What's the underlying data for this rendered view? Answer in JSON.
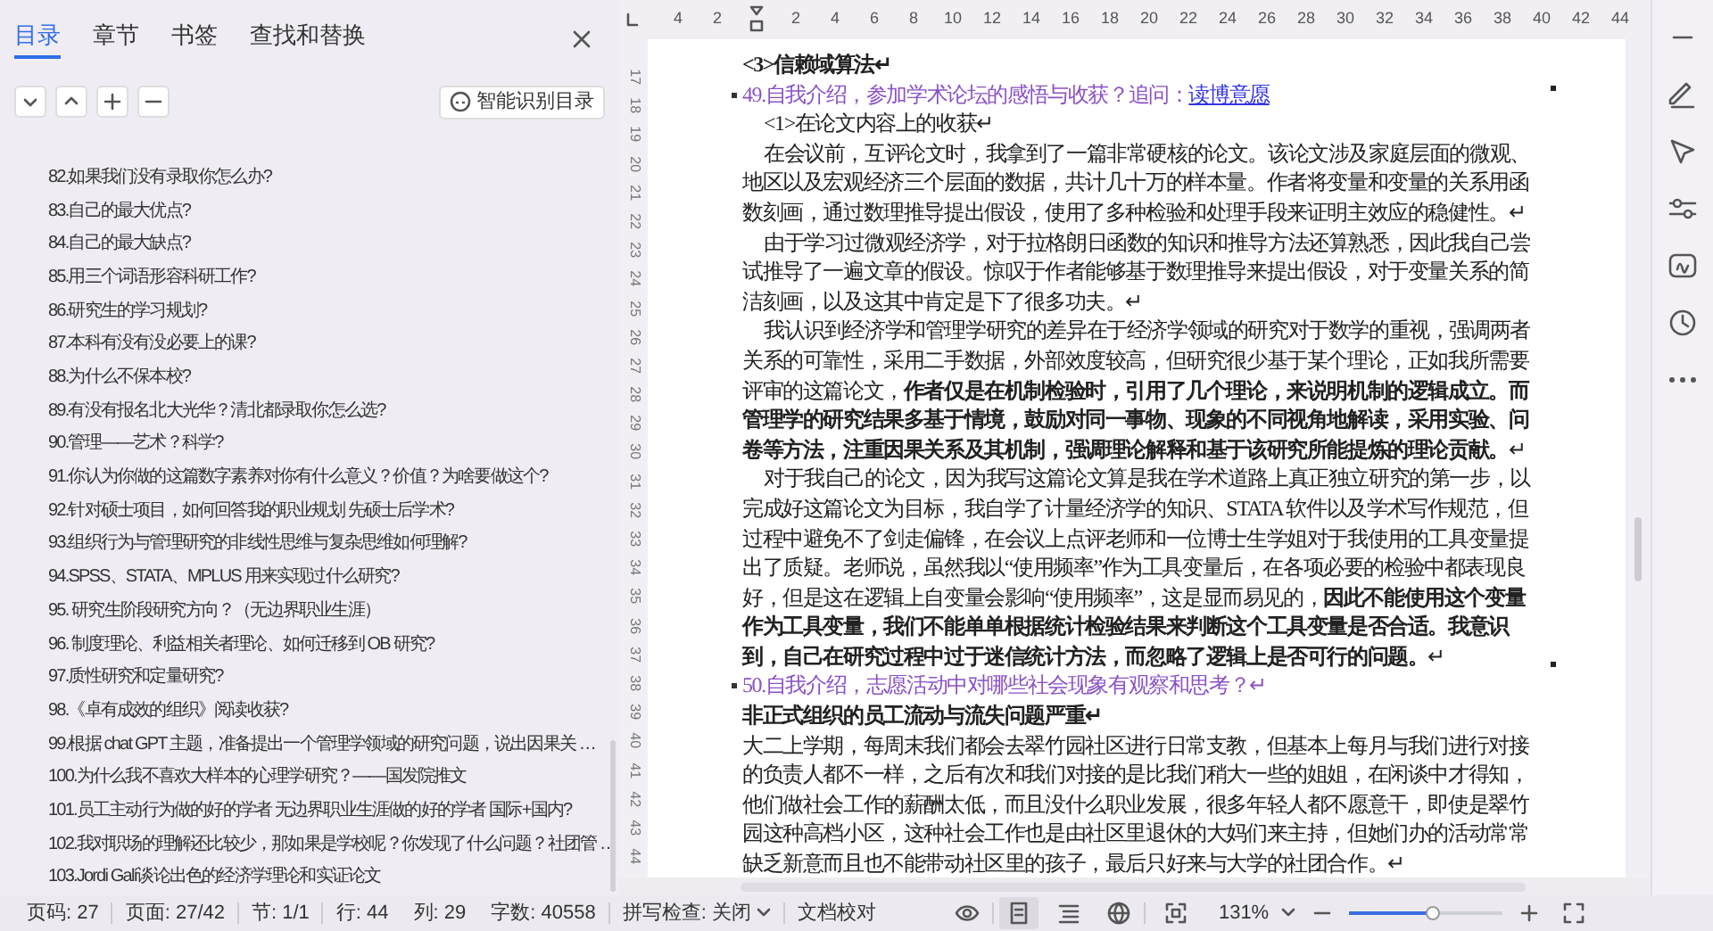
{
  "left_panel": {
    "tabs": [
      {
        "label": "目录",
        "selected": true
      },
      {
        "label": "章节",
        "selected": false
      },
      {
        "label": "书签",
        "selected": false
      },
      {
        "label": "查找和替换",
        "selected": false
      }
    ],
    "smart_button": "智能识别目录",
    "toc_items": [
      "82.如果我们没有录取你怎么办?",
      "83.自己的最大优点?",
      "84.自己的最大缺点?",
      "85.用三个词语形容科研工作?",
      "86.研究生的学习规划?",
      "87.本科有没有没必要上的课?",
      "88.为什么不保本校?",
      "89.有没有报名北大光华？清北都录取你怎么选?",
      "90.管理——艺术？科学?",
      "91.你认为你做的这篇数字素养对你有什么意义？价值？为啥要做这个?",
      "92.针对硕士项目，如何回答我的职业规划 先硕士后学术?",
      "93.组织行为与管理研究的非线性思维与复杂思维如何理解?",
      "94.SPSS、STATA、MPLUS 用来实现过什么研究?",
      "95. 研究生阶段研究方向？（无边界职业生涯）",
      "96. 制度理论、利益相关者理论、如何迁移到 OB 研究?",
      "97.质性研究和定量研究?",
      "98.《卓有成效的组织》阅读收获?",
      "99.根据 chat GPT 主题，准备提出一个管理学领域的研究问题，说出因果关 …",
      "100.为什么我不喜欢大样本的心理学研究？——国发院推文",
      "101.员工主动行为做的好的学者 无边界职业生涯做的好的学者 国际+国内?",
      "102.我对职场的理解还比较少，那如果是学校呢？你发现了什么问题？社团管 …",
      "103.Jordi Galí谈论出色的经济学理论和实证论文"
    ]
  },
  "ruler": {
    "left_ticks": [
      "4",
      "2"
    ],
    "ticks": [
      "2",
      "4",
      "6",
      "8",
      "10",
      "12",
      "14",
      "16",
      "18",
      "20",
      "22",
      "24",
      "26",
      "28",
      "30",
      "32",
      "34",
      "36",
      "38",
      "40",
      "42",
      "44"
    ]
  },
  "line_numbers": [
    "17",
    "18",
    "19",
    "20",
    "21",
    "22",
    "23",
    "24",
    "25",
    "26",
    "27",
    "28",
    "29",
    "30",
    "31",
    "32",
    "33",
    "34",
    "35",
    "36",
    "37",
    "38",
    "39",
    "40",
    "41",
    "42",
    "43",
    "44"
  ],
  "document": [
    {
      "kind": "bold_line",
      "text": "<3>信赖域算法↵"
    },
    {
      "kind": "question",
      "text": "49.自我介绍，参加学术论坛的感悟与收获？追问：",
      "link": "读博意愿"
    },
    {
      "kind": "subheading",
      "text": "<1>在论文内容上的收获↵"
    },
    {
      "kind": "paragraph",
      "text": "在会议前，互评论文时，我拿到了一篇非常硬核的论文。该论文涉及家庭层面的微观、地区以及宏观经济三个层面的数据，共计几十万的样本量。作者将变量和变量的关系用函数刻画，通过数理推导提出假设，使用了多种检验和处理手段来证明主效应的稳健性。↵"
    },
    {
      "kind": "paragraph",
      "text": "由于学习过微观经济学，对于拉格朗日函数的知识和推导方法还算熟悉，因此我自己尝试推导了一遍文章的假设。惊叹于作者能够基于数理推导来提出假设，对于变量关系的简洁刻画，以及这其中肯定是下了很多功夫。↵"
    },
    {
      "kind": "paragraph",
      "text": "我认识到经济学和管理学研究的差异在于经济学领域的研究对于数学的重视，强调两者关系的可靠性，采用二手数据，外部效度较高，但研究很少基于某个理论，正如我所需要评审的这篇论文，**作者仅是在机制检验时，引用了几个理论，来说明机制的逻辑成立。而管理学的研究结果多基于情境，鼓励对同一事物、现象的不同视角地解读，采用实验、问卷等方法，注重因果关系及其机制，强调理论解释和基于该研究所能提炼的理论贡献。**↵"
    },
    {
      "kind": "paragraph",
      "text": "对于我自己的论文，因为我写这篇论文算是我在学术道路上真正独立研究的第一步，以完成好这篇论文为目标，我自学了计量经济学的知识、STATA 软件以及学术写作规范，但过程中避免不了剑走偏锋，在会议上点评老师和一位博士生学姐对于我使用的工具变量提出了质疑。老师说，虽然我以“使用频率”作为工具变量后，在各项必要的检验中都表现良好，但是这在逻辑上自变量会影响“使用频率”，这是显而易见的，**因此不能使用这个变量作为工具变量，我们不能单单根据统计检验结果来判断这个工具变量是否合适。我意识到，自己在研究过程中过于迷信统计方法，而忽略了逻辑上是否可行的问题。**↵"
    },
    {
      "kind": "question",
      "text": "50.自我介绍，志愿活动中对哪些社会现象有观察和思考？↵"
    },
    {
      "kind": "bold_line",
      "text": "非正式组织的员工流动与流失问题严重↵"
    },
    {
      "kind": "plain",
      "text": "大二上学期，每周末我们都会去翠竹园社区进行日常支教，但基本上每月与我们进行对接的负责人都不一样，之后有次和我们对接的是比我们稍大一些的姐姐，在闲谈中才得知，他们做社会工作的薪酬太低，而且没什么职业发展，很多年轻人都不愿意干，即使是翠竹园这种高档小区，这种社会工作也是由社区里退休的大妈们来主持，但她们办的活动常常缺乏新意而且也不能带动社区里的孩子，最后只好来与大学的社团合作。↵"
    }
  ],
  "status_bar": {
    "items": [
      "页码: 27",
      "页面: 27/42",
      "节: 1/1",
      "行: 44",
      "列: 29",
      "字数: 40558"
    ],
    "spell_check": "拼写检查: 关闭",
    "proofread": "文档校对",
    "view_modes": [
      {
        "kind": "read",
        "selected": false
      },
      {
        "kind": "page",
        "selected": true
      },
      {
        "kind": "outline",
        "selected": false
      },
      {
        "kind": "web",
        "selected": false
      }
    ],
    "zoom": "131%",
    "zoom_slider": {
      "level": 0.54
    }
  }
}
